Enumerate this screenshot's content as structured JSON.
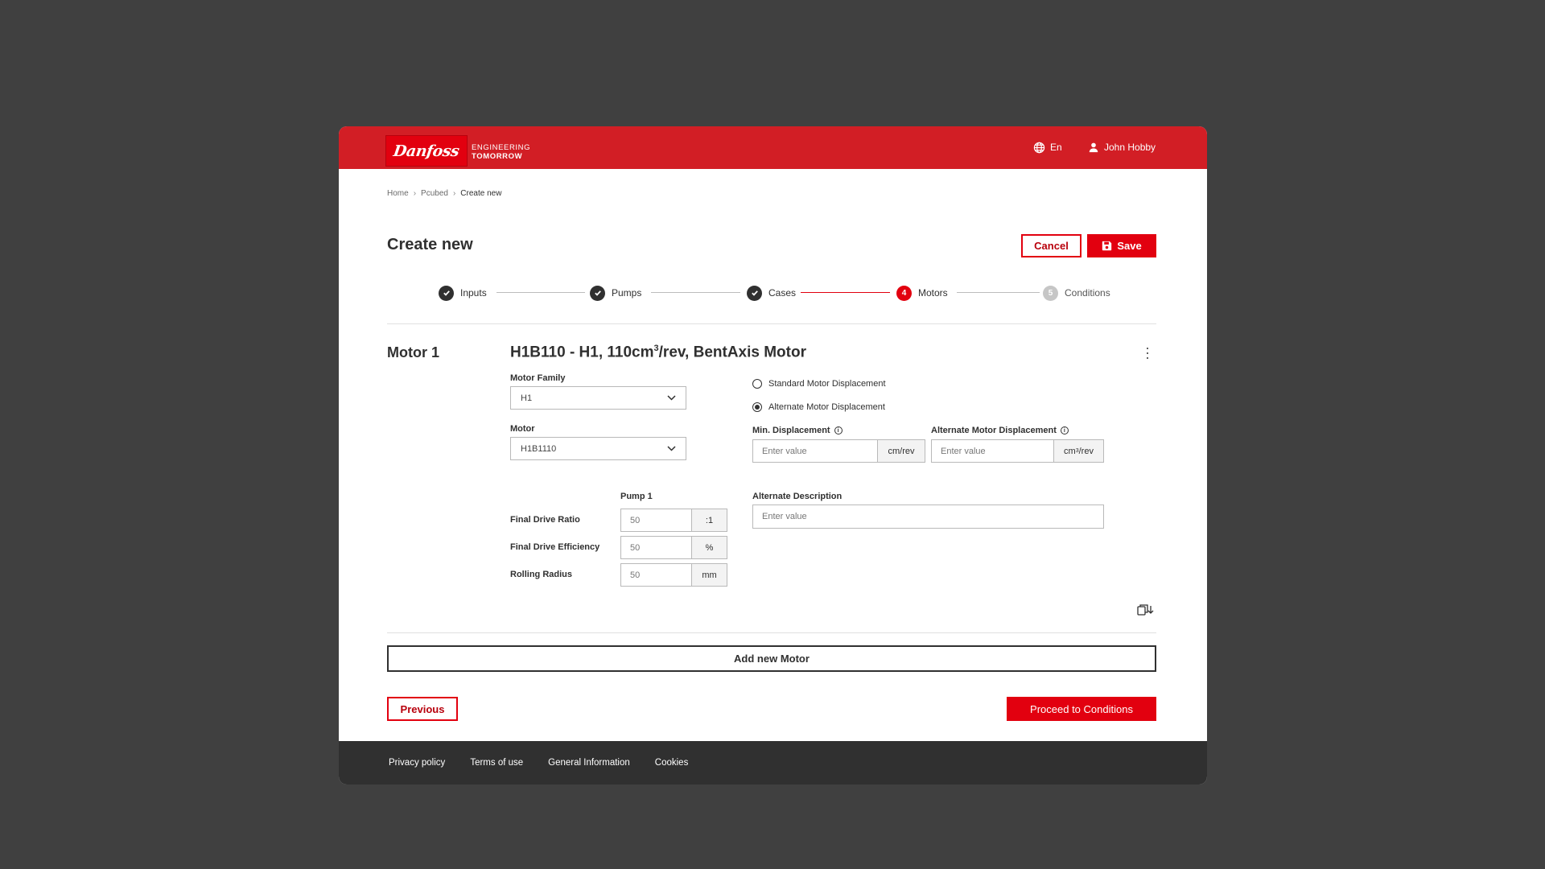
{
  "header": {
    "logo_text": "Danfoss",
    "tagline_line1": "ENGINEERING",
    "tagline_line2": "TOMORROW",
    "language": "En",
    "user_name": "John Hobby",
    "brand_color": "#e2000f",
    "header_color": "#d21e25"
  },
  "breadcrumb": [
    "Home",
    "Pcubed",
    "Create new"
  ],
  "page": {
    "title": "Create new",
    "cancel_label": "Cancel",
    "save_label": "Save"
  },
  "stepper": [
    {
      "label": "Inputs",
      "state": "done"
    },
    {
      "label": "Pumps",
      "state": "done"
    },
    {
      "label": "Cases",
      "state": "done"
    },
    {
      "label": "Motors",
      "state": "active",
      "number": "4"
    },
    {
      "label": "Conditions",
      "state": "pending",
      "number": "5"
    }
  ],
  "motor": {
    "section_label": "Motor 1",
    "title_prefix": "H1B110 - H1, 110cm",
    "title_sup": "3",
    "title_suffix": "/rev, BentAxis Motor",
    "family_label": "Motor Family",
    "family_value": "H1",
    "motor_label": "Motor",
    "motor_value": "H1B1110",
    "radio_standard": "Standard Motor Displacement",
    "radio_alternate": "Alternate Motor Displacement",
    "selected_radio": "alternate",
    "min_disp_label": "Min. Displacement",
    "min_disp_placeholder": "Enter value",
    "min_disp_unit": "cm/rev",
    "alt_disp_label": "Alternate Motor Displacement",
    "alt_disp_placeholder": "Enter value",
    "alt_disp_unit_base": "cm",
    "alt_disp_unit_sup": "3",
    "alt_disp_unit_tail": "/rev",
    "pump_header": "Pump 1",
    "rows": [
      {
        "label": "Final Drive Ratio",
        "value": "50",
        "unit": ":1"
      },
      {
        "label": "Final Drive Efficiency",
        "value": "50",
        "unit": "%"
      },
      {
        "label": "Rolling Radius",
        "value": "50",
        "unit": "mm"
      }
    ],
    "alt_desc_label": "Alternate Description",
    "alt_desc_placeholder": "Enter value"
  },
  "actions": {
    "add_motor": "Add new Motor",
    "previous": "Previous",
    "proceed": "Proceed to Conditions"
  },
  "footer": [
    "Privacy policy",
    "Terms of use",
    "General Information",
    "Cookies"
  ]
}
